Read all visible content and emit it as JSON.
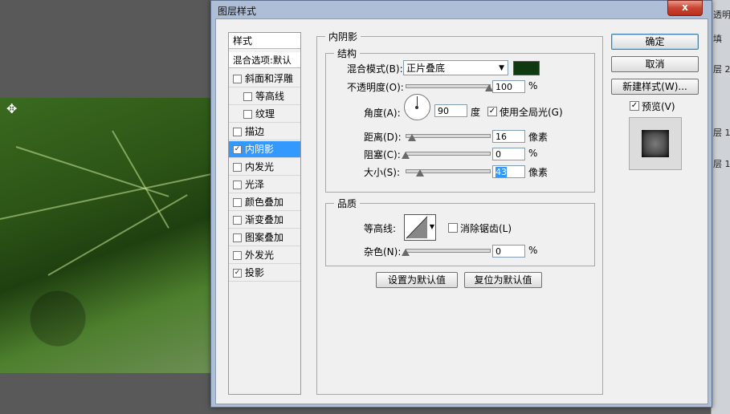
{
  "dialog": {
    "title": "图层样式",
    "close_glyph": "x"
  },
  "style_list": {
    "header": "样式",
    "blend_default": "混合选项:默认",
    "items": [
      {
        "label": "斜面和浮雕",
        "checked": false,
        "indent": false
      },
      {
        "label": "等高线",
        "checked": false,
        "indent": true
      },
      {
        "label": "纹理",
        "checked": false,
        "indent": true
      },
      {
        "label": "描边",
        "checked": false,
        "indent": false
      },
      {
        "label": "内阴影",
        "checked": true,
        "indent": false,
        "selected": true
      },
      {
        "label": "内发光",
        "checked": false,
        "indent": false
      },
      {
        "label": "光泽",
        "checked": false,
        "indent": false
      },
      {
        "label": "颜色叠加",
        "checked": false,
        "indent": false
      },
      {
        "label": "渐变叠加",
        "checked": false,
        "indent": false
      },
      {
        "label": "图案叠加",
        "checked": false,
        "indent": false
      },
      {
        "label": "外发光",
        "checked": false,
        "indent": false
      },
      {
        "label": "投影",
        "checked": true,
        "indent": false
      }
    ]
  },
  "inner_shadow": {
    "title": "内阴影",
    "structure": {
      "title": "结构",
      "blend_mode_label": "混合模式(B):",
      "blend_mode_value": "正片叠底",
      "shadow_color": "#0f3a10",
      "opacity_label": "不透明度(O):",
      "opacity_value": "100",
      "opacity_unit": "%",
      "opacity_fraction": 1.0,
      "angle_label": "角度(A):",
      "angle_value": "90",
      "angle_unit": "度",
      "global_light_label": "使用全局光(G)",
      "global_light_checked": true,
      "distance_label": "距离(D):",
      "distance_value": "16",
      "distance_unit": "像素",
      "distance_fraction": 0.08,
      "choke_label": "阻塞(C):",
      "choke_value": "0",
      "choke_unit": "%",
      "choke_fraction": 0.0,
      "size_label": "大小(S):",
      "size_value": "43",
      "size_unit": "像素",
      "size_fraction": 0.17
    },
    "quality": {
      "title": "品质",
      "contour_label": "等高线:",
      "anti_alias_label": "消除锯齿(L)",
      "anti_alias_checked": false,
      "noise_label": "杂色(N):",
      "noise_value": "0",
      "noise_unit": "%",
      "noise_fraction": 0.0
    },
    "set_default_label": "设置为默认值",
    "reset_default_label": "复位为默认值"
  },
  "buttons": {
    "ok": "确定",
    "cancel": "取消",
    "new_style": "新建样式(W)...",
    "preview_label": "预览(V)",
    "preview_checked": true
  },
  "background": {
    "panel_tabs": [
      "透明",
      "填",
      "层 2",
      "层 1",
      "层 1"
    ]
  }
}
